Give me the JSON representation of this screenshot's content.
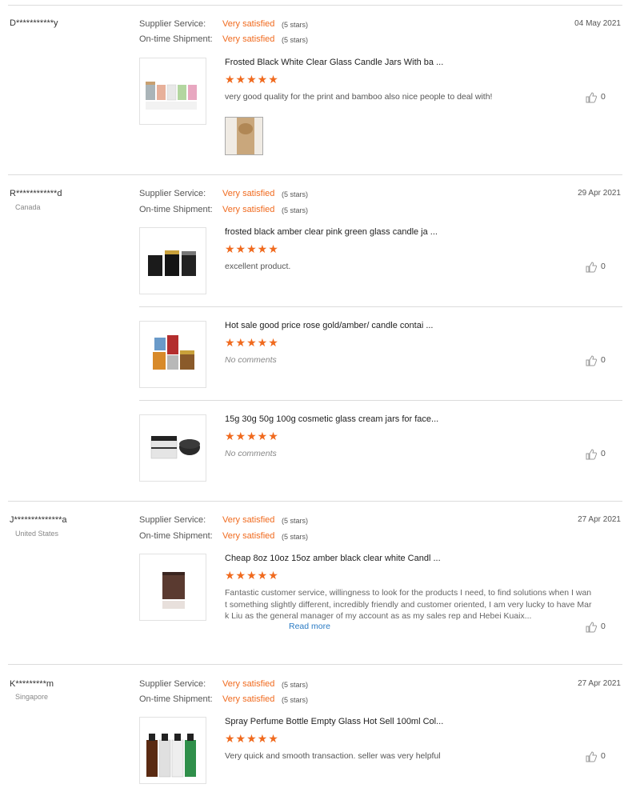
{
  "labels": {
    "supplier_service": "Supplier Service:",
    "ontime_shipment": "On-time Shipment:",
    "very_satisfied": "Very satisfied",
    "five_stars": "(5 stars)",
    "stars": "★★★★★",
    "read_more": "Read more"
  },
  "reviews": [
    {
      "buyer": "D***********y",
      "country": "",
      "date": "04 May 2021",
      "products": [
        {
          "title": "Frosted Black White Clear Glass Candle Jars With ba ...",
          "rating": 5,
          "comment": "very good quality for the print and bamboo also nice people to deal with!",
          "likes": "0"
        }
      ]
    },
    {
      "buyer": "R************d",
      "country": "Canada",
      "date": "29 Apr 2021",
      "products": [
        {
          "title": "frosted black amber clear pink green glass candle ja ...",
          "rating": 5,
          "comment": "excellent product.",
          "likes": "0"
        },
        {
          "title": "Hot sale good price rose gold/amber/ candle contai ...",
          "rating": 5,
          "comment": "No comments",
          "likes": "0"
        },
        {
          "title": "15g 30g 50g 100g cosmetic glass cream jars for face...",
          "rating": 5,
          "comment": "No comments",
          "likes": "0"
        }
      ]
    },
    {
      "buyer": "J**************a",
      "country": "United States",
      "date": "27 Apr 2021",
      "products": [
        {
          "title": "Cheap 8oz 10oz 15oz amber black clear white Candl ...",
          "rating": 5,
          "comment": "Fantastic customer service, willingness to look for the products I need, to find solutions when I want something slightly different, incredibly friendly and customer oriented, I am very lucky to have Mark Liu as the general manager of my account as as my sales rep and Hebei Kuaix...",
          "likes": "0"
        }
      ]
    },
    {
      "buyer": "K*********m",
      "country": "Singapore",
      "date": "27 Apr 2021",
      "products": [
        {
          "title": "Spray Perfume Bottle Empty Glass Hot Sell 100ml Col...",
          "rating": 5,
          "comment": "Very quick and smooth transaction. seller was very helpful",
          "likes": "0"
        }
      ]
    }
  ],
  "colors": {
    "accent": "#f06a1e",
    "link": "#2a7bc4",
    "divider": "#dcdcdc"
  },
  "icons": {
    "like": "thumbs-up-icon"
  }
}
